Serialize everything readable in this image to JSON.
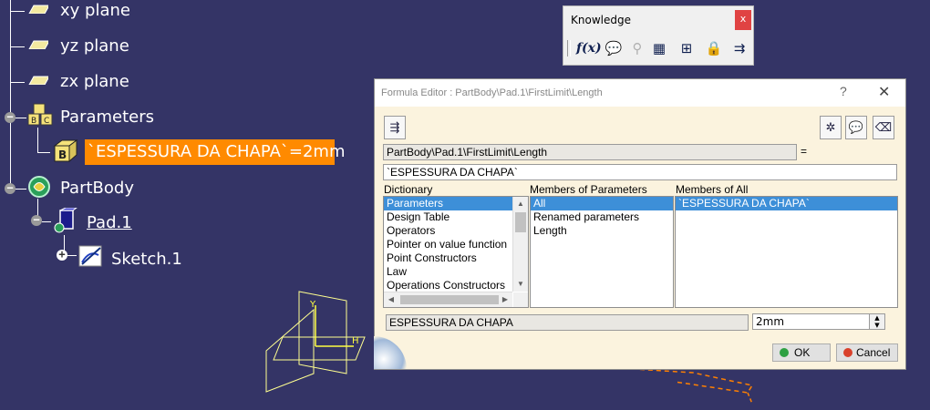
{
  "tree": {
    "planes": [
      "xy plane",
      "yz plane",
      "zx plane"
    ],
    "parameters_label": "Parameters",
    "parameter_item": "`ESPESSURA DA CHAPA`=2mm",
    "partbody_label": "PartBody",
    "pad_label": "Pad.1",
    "sketch_label": "Sketch.1"
  },
  "knowledge_toolbar": {
    "title": "Knowledge",
    "close": "x",
    "icons": [
      "formula-icon",
      "comment-icon",
      "check-icon",
      "table-icon",
      "network-icon",
      "lock-icon",
      "equivalence-icon"
    ]
  },
  "formula_editor": {
    "title": "Formula Editor : PartBody\\Pad.1\\FirstLimit\\Length",
    "help": "?",
    "close": "✕",
    "path_field": "PartBody\\Pad.1\\FirstLimit\\Length",
    "equals": "=",
    "formula_value": "`ESPESSURA DA CHAPA`",
    "dictionary": {
      "header": "Dictionary",
      "items": [
        "Parameters",
        "Design Table",
        "Operators",
        "Pointer on value function",
        "Point Constructors",
        "Law",
        "Operations Constructors"
      ],
      "selected": "Parameters"
    },
    "members_of_parameters": {
      "header": "Members of Parameters",
      "items": [
        "All",
        "Renamed parameters",
        "Length"
      ],
      "selected": "All"
    },
    "members_of_all": {
      "header": "Members of All",
      "items": [
        "`ESPESSURA DA CHAPA`"
      ],
      "selected": "`ESPESSURA DA CHAPA`"
    },
    "selected_name": "ESPESSURA DA CHAPA",
    "selected_value": "2mm",
    "ok_label": "OK",
    "cancel_label": "Cancel"
  },
  "colors": {
    "background": "#343466",
    "highlight": "#ff8a00",
    "dialog_bg": "#fbf3de",
    "selection": "#3d8fd8",
    "axis": "#ffff80",
    "sketch_orange": "#ff8000"
  }
}
